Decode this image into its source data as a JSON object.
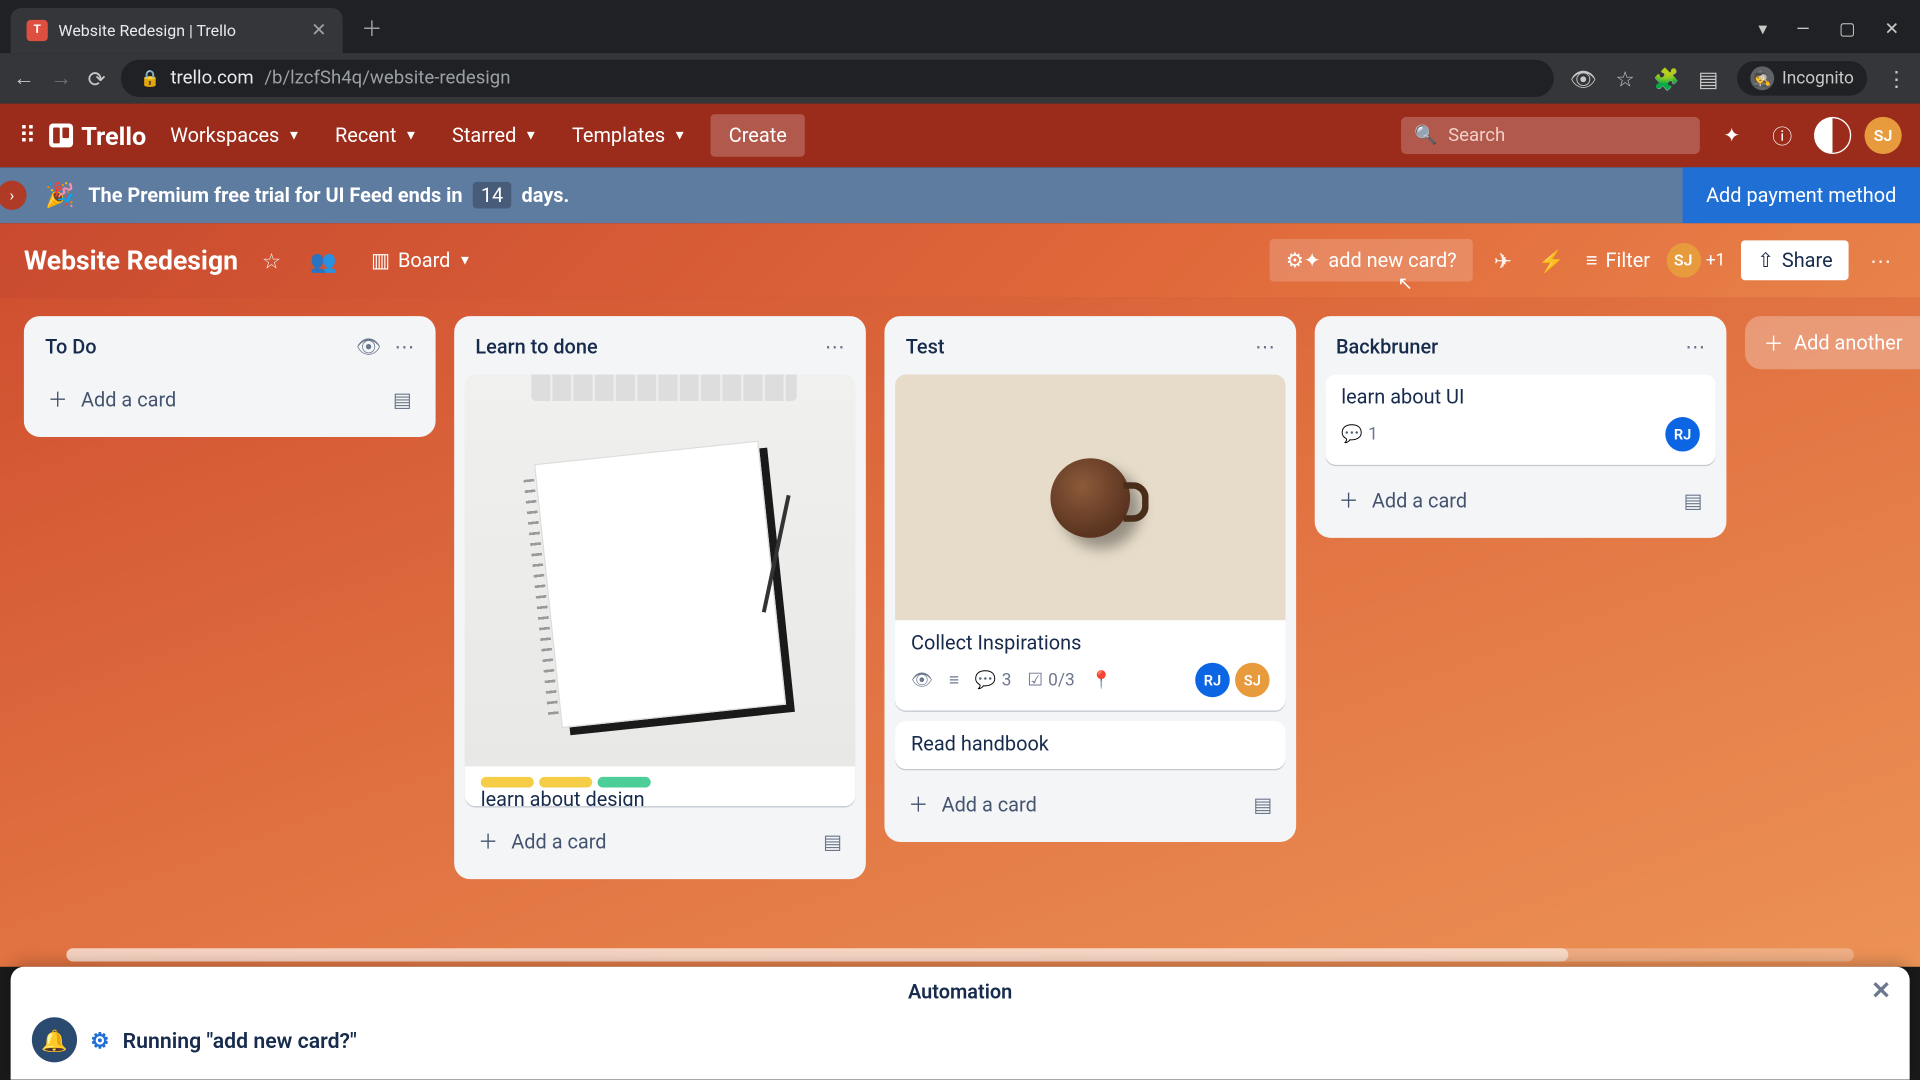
{
  "browser": {
    "tab_title": "Website Redesign | Trello",
    "url_host": "trello.com",
    "url_path": "/b/lzcfSh4q/website-redesign",
    "incognito_label": "Incognito"
  },
  "topbar": {
    "logo": "Trello",
    "menus": [
      "Workspaces",
      "Recent",
      "Starred",
      "Templates"
    ],
    "create": "Create",
    "search_placeholder": "Search",
    "avatar": "SJ"
  },
  "banner": {
    "text_pre": "The Premium free trial for UI Feed ends in",
    "days": "14",
    "text_post": "days.",
    "cta": "Add payment method"
  },
  "board_header": {
    "title": "Website Redesign",
    "view_label": "Board",
    "add_card_btn": "add new card?",
    "filter": "Filter",
    "plus_count": "+1",
    "share": "Share",
    "member": "SJ"
  },
  "lists": [
    {
      "name": "To Do",
      "cards": [],
      "add_label": "Add a card"
    },
    {
      "name": "Learn to done",
      "cards": [
        {
          "title": "learn about design",
          "cover": "notebook",
          "labels": [
            "#f5cd47",
            "#f5cd47",
            "#4bce97"
          ]
        }
      ],
      "add_label": "Add a card"
    },
    {
      "name": "Test",
      "cards": [
        {
          "title": "Collect Inspirations",
          "cover": "coffee",
          "badges": {
            "watch": true,
            "desc": true,
            "comments": "3",
            "checklist": "0/3",
            "location": true
          },
          "members": [
            "RJ",
            "SJ"
          ]
        },
        {
          "title": "Read handbook"
        }
      ],
      "add_label": "Add a card"
    },
    {
      "name": "Backbruner",
      "cards": [
        {
          "title": "learn about UI",
          "badges": {
            "comments": "1"
          },
          "members": [
            "RJ"
          ]
        }
      ],
      "add_label": "Add a card"
    }
  ],
  "add_list_label": "Add another",
  "automation": {
    "title": "Automation",
    "running": "Running \"add new card?\""
  },
  "colors": {
    "accent": "#9b2b1a",
    "banner_btn": "#1f6fd4"
  }
}
